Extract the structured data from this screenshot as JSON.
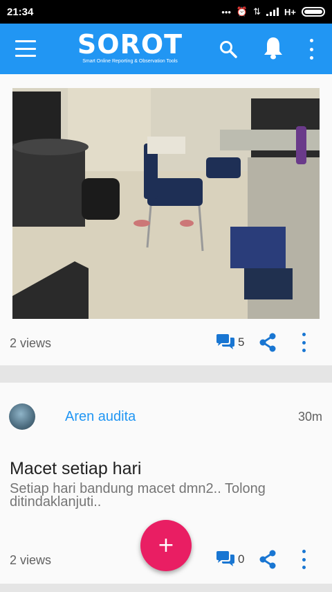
{
  "status_bar": {
    "time": "21:34",
    "network": "H+"
  },
  "app_bar": {
    "logo_text": "SOROT",
    "logo_subtitle": "Smart Online Reporting & Observation Tools",
    "icons": [
      "menu-icon",
      "search-icon",
      "bell-icon",
      "more-vert-icon"
    ],
    "color": "#2196f3"
  },
  "posts": [
    {
      "views": "2 views",
      "comment_count": "5",
      "image": "office-room-photo"
    },
    {
      "author": "Aren audita",
      "time_ago": "30m",
      "title": "Macet setiap hari",
      "description": "Setiap hari bandung macet dmn2.. Tolong ditindaklanjuti..",
      "views": "2 views",
      "comment_count": "0"
    }
  ],
  "fab": {
    "label": "+",
    "color": "#e91e63"
  },
  "colors": {
    "accent": "#1976d2",
    "brand": "#2196f3",
    "fab": "#e91e63"
  }
}
